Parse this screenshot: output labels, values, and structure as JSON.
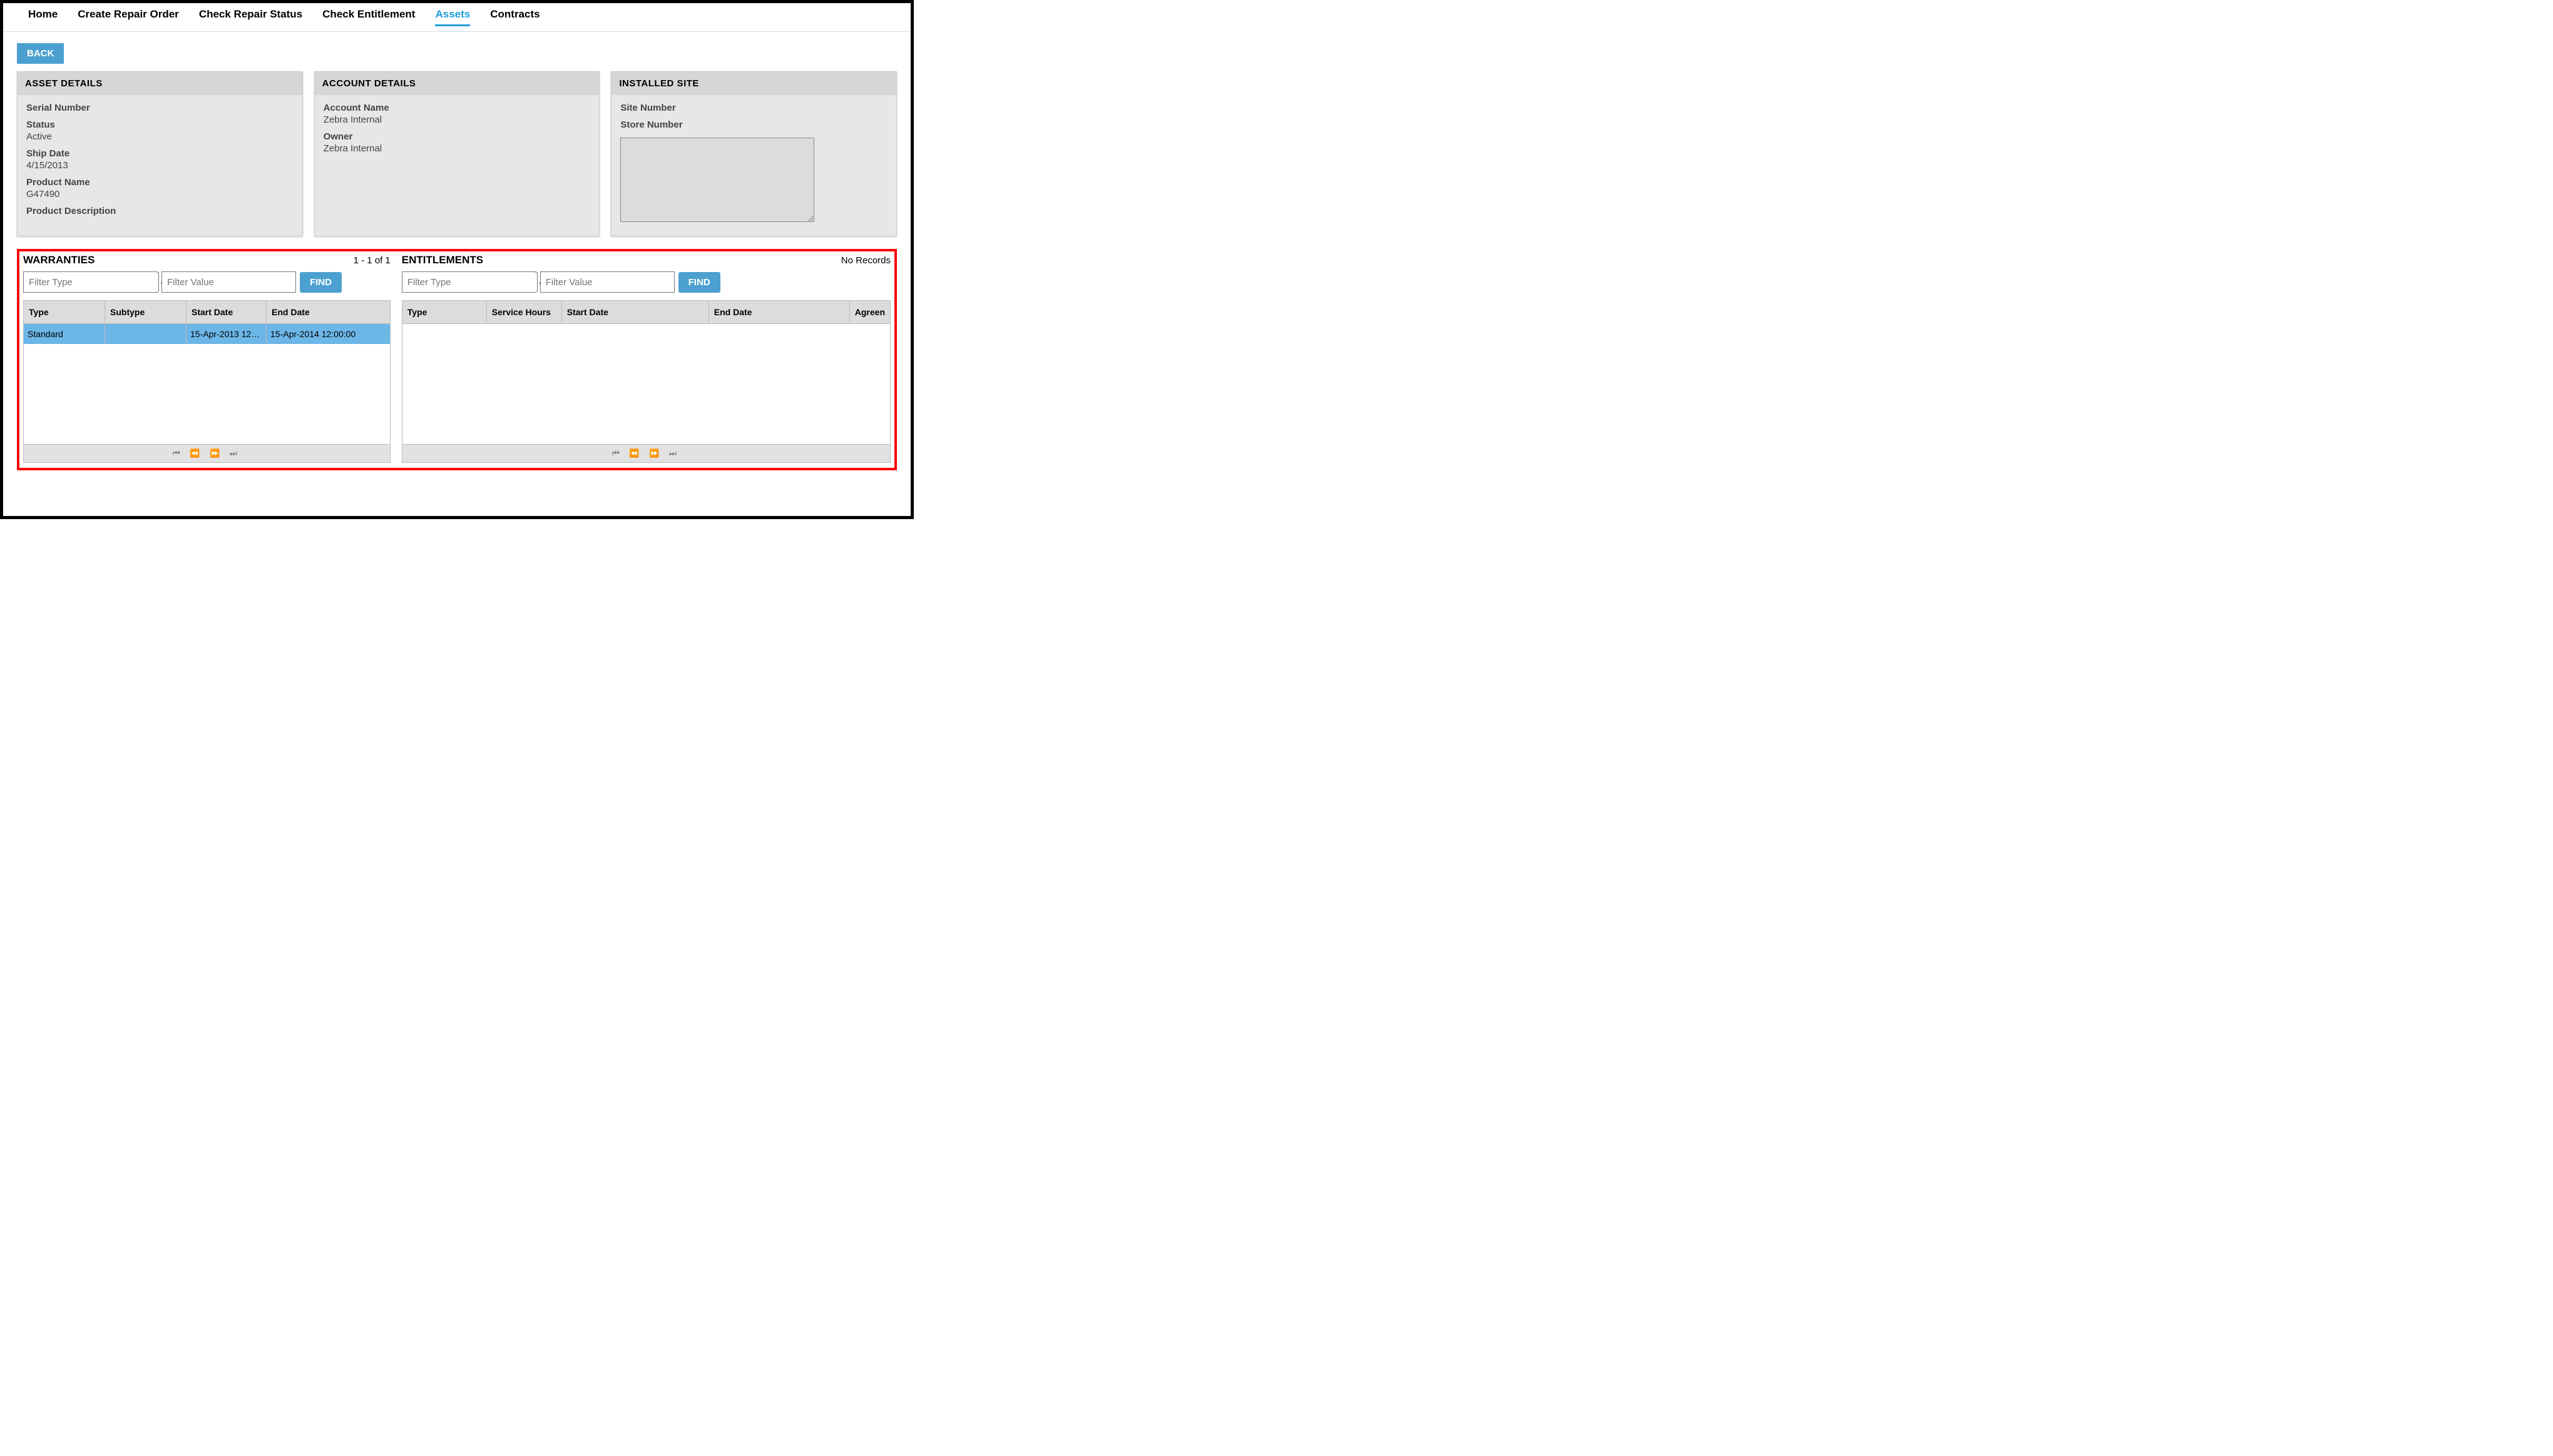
{
  "nav": {
    "items": [
      "Home",
      "Create Repair Order",
      "Check Repair Status",
      "Check Entitlement",
      "Assets",
      "Contracts"
    ],
    "active_index": 4
  },
  "back_label": "BACK",
  "asset_details": {
    "title": "ASSET DETAILS",
    "serial_number_label": "Serial Number",
    "serial_number_value": "",
    "status_label": "Status",
    "status_value": "Active",
    "ship_date_label": "Ship Date",
    "ship_date_value": "4/15/2013",
    "product_name_label": "Product Name",
    "product_name_value": "G47490",
    "product_description_label": "Product Description",
    "product_description_value": ""
  },
  "account_details": {
    "title": "ACCOUNT DETAILS",
    "account_name_label": "Account Name",
    "account_name_value": "Zebra Internal",
    "owner_label": "Owner",
    "owner_value": "Zebra Internal"
  },
  "installed_site": {
    "title": "INSTALLED SITE",
    "site_number_label": "Site Number",
    "store_number_label": "Store Number",
    "notes_value": ""
  },
  "warranties": {
    "title": "WARRANTIES",
    "count_text": "1 - 1 of 1",
    "filter_type_placeholder": "Filter Type",
    "filter_value_placeholder": "Filter Value",
    "find_label": "FIND",
    "columns": [
      "Type",
      "Subtype",
      "Start Date",
      "End Date"
    ],
    "rows": [
      {
        "type": "Standard",
        "subtype": "",
        "start": "15-Apr-2013 12:0...",
        "end": "15-Apr-2014 12:00:00"
      }
    ]
  },
  "entitlements": {
    "title": "ENTITLEMENTS",
    "count_text": "No Records",
    "filter_type_placeholder": "Filter Type",
    "filter_value_placeholder": "Filter Value",
    "find_label": "FIND",
    "columns": [
      "Type",
      "Service Hours",
      "Start Date",
      "End Date",
      "Agreen"
    ]
  }
}
